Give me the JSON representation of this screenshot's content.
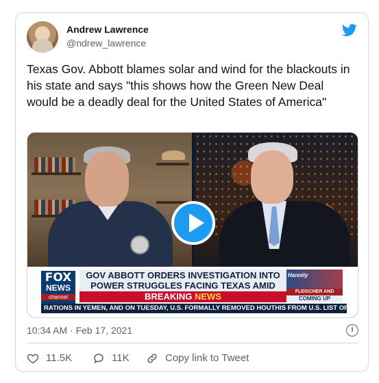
{
  "author": {
    "display_name": "Andrew Lawrence",
    "handle": "@ndrew_lawrence"
  },
  "tweet": {
    "text": "Texas Gov. Abbott blames solar and wind for the blackouts in his state and says \"this shows how the Green New Deal would be a deadly deal for the United States of America\"",
    "timestamp": "10:34 AM · Feb 17, 2021"
  },
  "video": {
    "fox_logo": {
      "line1": "FOX",
      "line2": "NEWS",
      "line3": "channel"
    },
    "headline": "GOV ABBOTT ORDERS INVESTIGATION INTO POWER STRUGGLES FACING TEXAS AMID BLACKOUTS",
    "breaking_prefix": "BREAKING ",
    "breaking_word": "NEWS",
    "promo_show": "Hannity",
    "promo_names": "FLEISCHER AND DEVINE",
    "promo_coming": "COMING UP",
    "ticker": "RATIONS IN YEMEN, AND ON TUESDAY, U.S. FORMALLY REMOVED HOUTHIS FROM U.S. LIST OF FOREIGN T"
  },
  "actions": {
    "likes": "11.5K",
    "replies": "11K",
    "copy_link": "Copy link to Tweet"
  },
  "colors": {
    "brand_blue": "#1d9bf0",
    "text_secondary": "#536471",
    "border": "#cfd9de"
  },
  "icons": {
    "brand": "twitter-bird-icon",
    "like": "heart-icon",
    "reply": "reply-bubble-icon",
    "copy": "link-icon",
    "info": "info-icon",
    "play": "play-icon"
  }
}
